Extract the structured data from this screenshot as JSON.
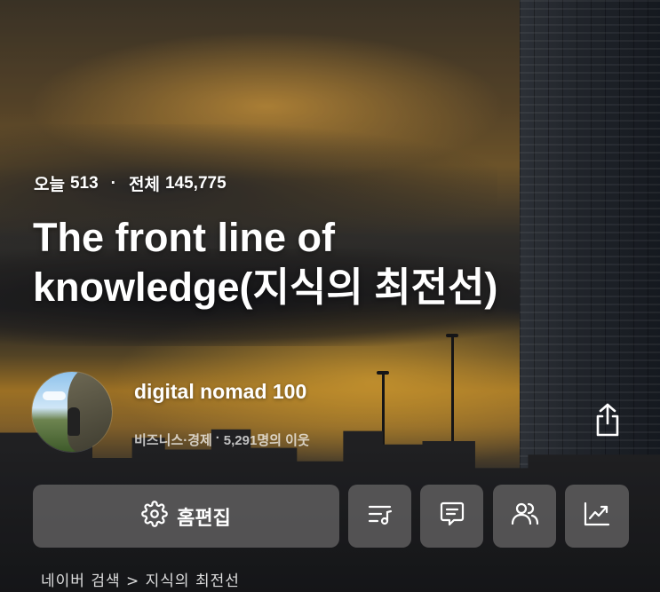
{
  "stats": {
    "today_label": "오늘",
    "today_count": "513",
    "separator": "·",
    "total_label": "전체",
    "total_count": "145,775"
  },
  "blog": {
    "title": "The front line of knowledge(지식의 최전선)"
  },
  "author": {
    "name": "digital nomad 100",
    "category": "비즈니스·경제",
    "meta_separator": "·",
    "neighbors": "5,291명의 이웃"
  },
  "actions": {
    "edit_label": "홈편집",
    "icons": [
      "gear-icon",
      "playlist-icon",
      "comment-icon",
      "people-icon",
      "stats-chart-icon",
      "share-icon"
    ]
  },
  "breadcrumb": "네이버 검색 > 지식의 최전선"
}
